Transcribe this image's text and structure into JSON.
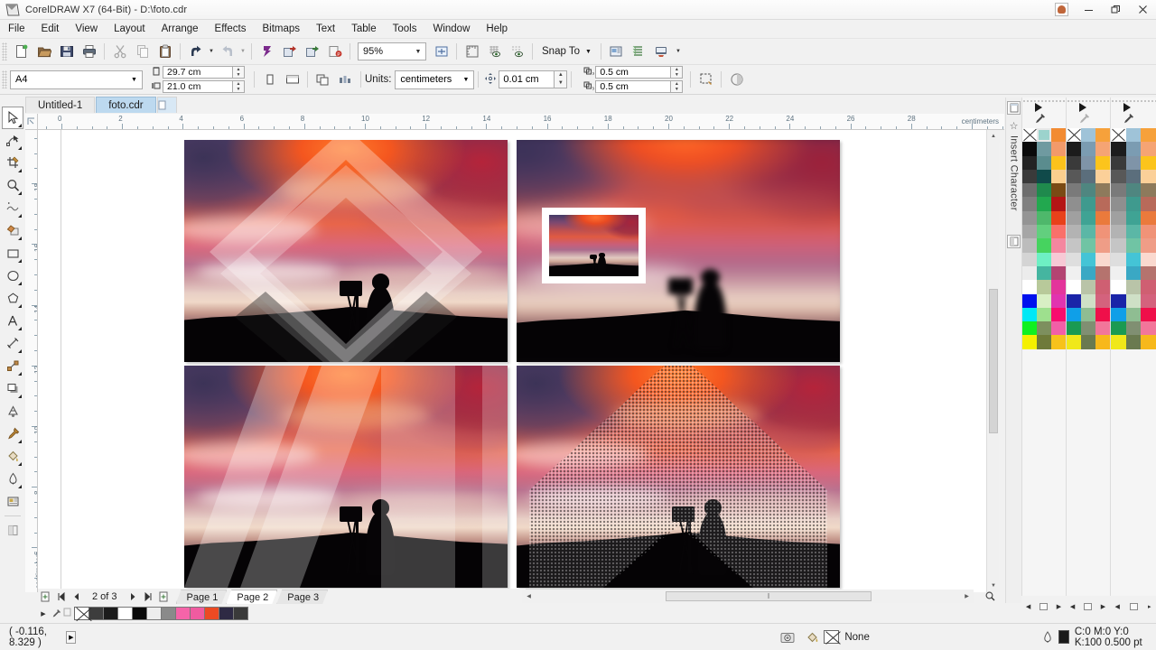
{
  "window": {
    "title": "CorelDRAW X7 (64-Bit) - D:\\foto.cdr",
    "logo_icon": "coreldraw-logo-icon",
    "account_icon": "user-account-icon",
    "minimize_label": "–",
    "restore_label": "❐",
    "close_label": "✕"
  },
  "menubar": {
    "items": [
      {
        "label": "File"
      },
      {
        "label": "Edit"
      },
      {
        "label": "View"
      },
      {
        "label": "Layout"
      },
      {
        "label": "Arrange"
      },
      {
        "label": "Effects"
      },
      {
        "label": "Bitmaps"
      },
      {
        "label": "Text"
      },
      {
        "label": "Table"
      },
      {
        "label": "Tools"
      },
      {
        "label": "Window"
      },
      {
        "label": "Help"
      }
    ]
  },
  "toolbar": {
    "buttons": [
      {
        "name": "new-document-button",
        "icon": "new-page-icon"
      },
      {
        "name": "open-document-button",
        "icon": "folder-open-icon"
      },
      {
        "name": "save-document-button",
        "icon": "floppy-save-icon"
      },
      {
        "name": "print-button",
        "icon": "printer-icon"
      },
      {
        "name": "cut-button",
        "icon": "scissors-icon"
      },
      {
        "name": "copy-button",
        "icon": "copy-icon"
      },
      {
        "name": "paste-button",
        "icon": "clipboard-paste-icon"
      },
      {
        "name": "undo-button",
        "icon": "undo-arrow-icon"
      },
      {
        "name": "redo-button",
        "icon": "redo-arrow-icon"
      },
      {
        "name": "search-content-button",
        "icon": "corel-connect-icon"
      },
      {
        "name": "import-button",
        "icon": "import-icon"
      },
      {
        "name": "export-button",
        "icon": "export-icon"
      },
      {
        "name": "publish-pdf-button",
        "icon": "pdf-export-icon"
      }
    ],
    "zoom_level": "95%",
    "zoom_dropdown_arrow": "▼",
    "fullscreen_button": "zoom-to-fit-icon",
    "view_buttons": [
      {
        "name": "show-rulers-button",
        "icon": "ruler-icon"
      },
      {
        "name": "show-grid-button",
        "icon": "grid-eye-icon"
      },
      {
        "name": "show-guidelines-button",
        "icon": "guideline-eye-icon"
      }
    ],
    "snap_to_label": "Snap To",
    "snap_to_arrow": "▼",
    "right_buttons": [
      {
        "name": "options-button",
        "icon": "options-dialog-icon"
      },
      {
        "name": "object-manager-button",
        "icon": "object-manager-icon"
      },
      {
        "name": "application-launcher-button",
        "icon": "app-launcher-icon"
      }
    ],
    "launcher_arrow": "▼"
  },
  "propertybar": {
    "page_preset": "A4",
    "page_preset_arrow": "▼",
    "page_width": "29.7 cm",
    "page_height": "21.0 cm",
    "width_icon": "page-width-icon",
    "height_icon": "page-height-icon",
    "spin_up": "▲",
    "spin_down": "▼",
    "orientation_portrait": "portrait-icon",
    "orientation_landscape": "landscape-icon",
    "all_pages_icon": "all-pages-icon",
    "current_page_icon": "current-page-only-icon",
    "units_label": "Units:",
    "units_value": "centimeters",
    "units_arrow": "▼",
    "nudge_icon": "nudge-offset-icon",
    "nudge_value": "0.01 cm",
    "duplicate_x_icon": "duplicate-distance-x-icon",
    "duplicate_y_icon": "duplicate-distance-y-icon",
    "duplicate_x": "0.5 cm",
    "duplicate_y": "0.5 cm",
    "treat_as_filled_icon": "treat-as-filled-icon",
    "wireframe_icon": "wireframe-preview-icon"
  },
  "document_tabs": {
    "tabs": [
      {
        "label": "Untitled-1",
        "active": false
      },
      {
        "label": "foto.cdr",
        "active": true
      }
    ],
    "new_tab_icon": "new-tab-icon"
  },
  "toolbox": {
    "tools": [
      {
        "name": "pick-tool",
        "icon": "arrow-cursor-icon",
        "active": true,
        "flyout": true
      },
      {
        "name": "shape-tool",
        "icon": "node-edit-icon",
        "active": false,
        "flyout": true
      },
      {
        "name": "crop-tool",
        "icon": "crop-icon",
        "active": false,
        "flyout": true
      },
      {
        "name": "zoom-tool",
        "icon": "magnifier-icon",
        "active": false,
        "flyout": true
      },
      {
        "name": "freehand-tool",
        "icon": "freehand-curve-icon",
        "active": false,
        "flyout": true
      },
      {
        "name": "smart-fill-tool",
        "icon": "smart-fill-icon",
        "active": false,
        "flyout": true
      },
      {
        "name": "rectangle-tool",
        "icon": "rectangle-icon",
        "active": false,
        "flyout": true
      },
      {
        "name": "ellipse-tool",
        "icon": "ellipse-icon",
        "active": false,
        "flyout": true
      },
      {
        "name": "polygon-tool",
        "icon": "polygon-icon",
        "active": false,
        "flyout": true
      },
      {
        "name": "text-tool",
        "icon": "text-a-icon",
        "active": false,
        "flyout": true
      },
      {
        "name": "parallel-dimension-tool",
        "icon": "dimension-line-icon",
        "active": false,
        "flyout": true
      },
      {
        "name": "straight-line-connector-tool",
        "icon": "connector-icon",
        "active": false,
        "flyout": true
      },
      {
        "name": "drop-shadow-tool",
        "icon": "drop-shadow-icon",
        "active": false,
        "flyout": true
      },
      {
        "name": "transparency-tool",
        "icon": "transparency-icon",
        "active": false,
        "flyout": false
      },
      {
        "name": "color-eyedropper-tool",
        "icon": "eyedropper-icon",
        "active": false,
        "flyout": true
      },
      {
        "name": "interactive-fill-tool",
        "icon": "fill-bucket-icon",
        "active": false,
        "flyout": true
      },
      {
        "name": "outline-tool",
        "icon": "outline-pen-icon",
        "active": false,
        "flyout": true
      },
      {
        "name": "fill-tool",
        "icon": "fill-dialog-icon",
        "active": false,
        "flyout": false
      },
      {
        "name": "quick-preview-tool",
        "icon": "quick-preview-icon",
        "active": false,
        "flyout": false
      }
    ]
  },
  "rulers": {
    "unit_label": "centimeters",
    "horizontal_ticks": [
      0,
      2,
      4,
      6,
      8,
      10,
      12,
      14,
      16,
      18,
      20,
      22,
      24,
      26,
      28
    ],
    "vertical_ticks": [
      18,
      16,
      14,
      12,
      10,
      8,
      6
    ]
  },
  "canvas": {
    "images": [
      {
        "name": "photo-diamond-overlay",
        "alt": "Photographer silhouette at sunset with translucent diamond chevron overlay"
      },
      {
        "name": "photo-blur-with-inset",
        "alt": "Blurred sunset photo with sharp framed inset thumbnail"
      },
      {
        "name": "photo-diagonal-bands",
        "alt": "Sunset photo with translucent diagonal and vertical band overlay"
      },
      {
        "name": "photo-halftone-diamond",
        "alt": "Sunset photo with halftone dithered diamond overlay"
      }
    ]
  },
  "pagenav": {
    "add_page_start_icon": "add-page-icon",
    "first_page_icon": "⏮",
    "prev_page_icon": "◀",
    "counter": "2 of 3",
    "next_page_icon": "▶",
    "last_page_icon": "⏭",
    "add_page_end_icon": "add-page-icon",
    "pages": [
      {
        "label": "Page 1",
        "active": false
      },
      {
        "label": "Page 2",
        "active": true
      },
      {
        "label": "Page 3",
        "active": false
      }
    ]
  },
  "scrollbars": {
    "v_up": "▲",
    "v_down": "▼",
    "h_left": "◀",
    "h_right": "▶",
    "h_thumb_grip": "‖"
  },
  "palette_strip": {
    "scroll_left": "◀",
    "scroll_right": "▶",
    "eyedropper_icon": "eyedropper-icon",
    "none_swatch": "none-swatch-icon",
    "colors": [
      "#3d3d3d",
      "#1c1c1c",
      "#ffffff",
      "#0a0a0a",
      "#ededed",
      "#8a8a8a",
      "#f564a9",
      "#f05ba0",
      "#ec4a23",
      "#2e2a44",
      "#3a3a3a"
    ]
  },
  "statusbar": {
    "coordinates": "( -0.116, 8.329  )",
    "play_icon": "▶",
    "snapshot_icon": "camera-icon",
    "fill_icon": "fill-bucket-icon",
    "fill_value": "None",
    "outline_icon": "outline-pen-icon",
    "outline_color_hex": "#1a1a1a",
    "outline_value": "C:0 M:0 Y:0 K:100  0.500 pt"
  },
  "docker": {
    "top_icon": "docker-panel-icon",
    "star_icon": "☆",
    "label": "Insert Character",
    "bottom_icon": "color-palette-icon"
  },
  "color_palettes": {
    "header_caret": "▶",
    "dropper_icon": "eyedropper-icon",
    "footer": {
      "prev": "◀",
      "next": "▶",
      "expand": "▸"
    },
    "columns": [
      {
        "name": "palette-column-1",
        "colors": [
          "none",
          "#9cd3cd",
          "#f28b33",
          "#0a0a0a",
          "#6f9aa0",
          "#f29a6a",
          "#232323",
          "#5a8c8e",
          "#fcc21b",
          "#3a3a3a",
          "#104a4a",
          "#fbcf8e",
          "#6e6e6e",
          "#1f8a4d",
          "#7a4a14",
          "#808080",
          "#22a84f",
          "#b41515",
          "#949494",
          "#4eb86b",
          "#e8411a",
          "#a6a6a6",
          "#62cf7e",
          "#f9706a",
          "#bcbcbc",
          "#46d35f",
          "#f4879f",
          "#d4d4d4",
          "#6ef0c4",
          "#f7c9d5",
          "#ececec",
          "#45b5a0",
          "#b34472",
          "#ffffff",
          "#b8c99a",
          "#e3359b",
          "#0011ee",
          "#d8efc4",
          "#e134b0",
          "#00e8f5",
          "#9ee08e",
          "#f80d6e",
          "#10f020",
          "#7d8f5e",
          "#f25fa7",
          "#f4f000",
          "#6e7a3a",
          "#f7c21b"
        ]
      },
      {
        "name": "palette-column-2",
        "colors": [
          "none",
          "#9fc3d8",
          "#f6a13b",
          "#1c1c1c",
          "#7b9cb2",
          "#f5a474",
          "#3a3a3a",
          "#7f94a8",
          "#fcc41c",
          "#585858",
          "#5b6e7c",
          "#fbd099",
          "#7a7a7a",
          "#4f8680",
          "#8d7a5c",
          "#8f8f8f",
          "#3f9a8e",
          "#b86a5a",
          "#a0a0a0",
          "#3fa394",
          "#ea7a3c",
          "#b3b3b3",
          "#5bb7a6",
          "#f09378",
          "#c5c5c5",
          "#70c4a4",
          "#ef9d87",
          "#dedede",
          "#44c4d6",
          "#fad9cf",
          "#f0f0f0",
          "#3aa8c4",
          "#b5736e",
          "#ffffff",
          "#b9c4a8",
          "#cf5f72",
          "#1a24a8",
          "#cfe0c6",
          "#d4627d",
          "#0f9fe8",
          "#8fbd92",
          "#ef0f4a",
          "#1a9a52",
          "#808f72",
          "#f2769a",
          "#f0e81a",
          "#6a7a50",
          "#f7b81b"
        ]
      },
      {
        "name": "palette-column-3",
        "colors": [
          "none",
          "#9fc3d8",
          "#f6a13b",
          "#1c1c1c",
          "#7b9cb2",
          "#f5a474",
          "#3a3a3a",
          "#7f94a8",
          "#fcc41c",
          "#585858",
          "#5b6e7c",
          "#fbd099",
          "#7a7a7a",
          "#4f8680",
          "#8d7a5c",
          "#8f8f8f",
          "#3f9a8e",
          "#b86a5a",
          "#a0a0a0",
          "#3fa394",
          "#ea7a3c",
          "#b3b3b3",
          "#5bb7a6",
          "#f09378",
          "#c5c5c5",
          "#70c4a4",
          "#ef9d87",
          "#dedede",
          "#44c4d6",
          "#fad9cf",
          "#f0f0f0",
          "#3aa8c4",
          "#b5736e",
          "#ffffff",
          "#b9c4a8",
          "#cf5f72",
          "#1a24a8",
          "#cfe0c6",
          "#d4627d",
          "#0f9fe8",
          "#8fbd92",
          "#ef0f4a",
          "#1a9a52",
          "#808f72",
          "#f2769a",
          "#f0e81a",
          "#6a7a50",
          "#f7b81b"
        ]
      }
    ]
  }
}
